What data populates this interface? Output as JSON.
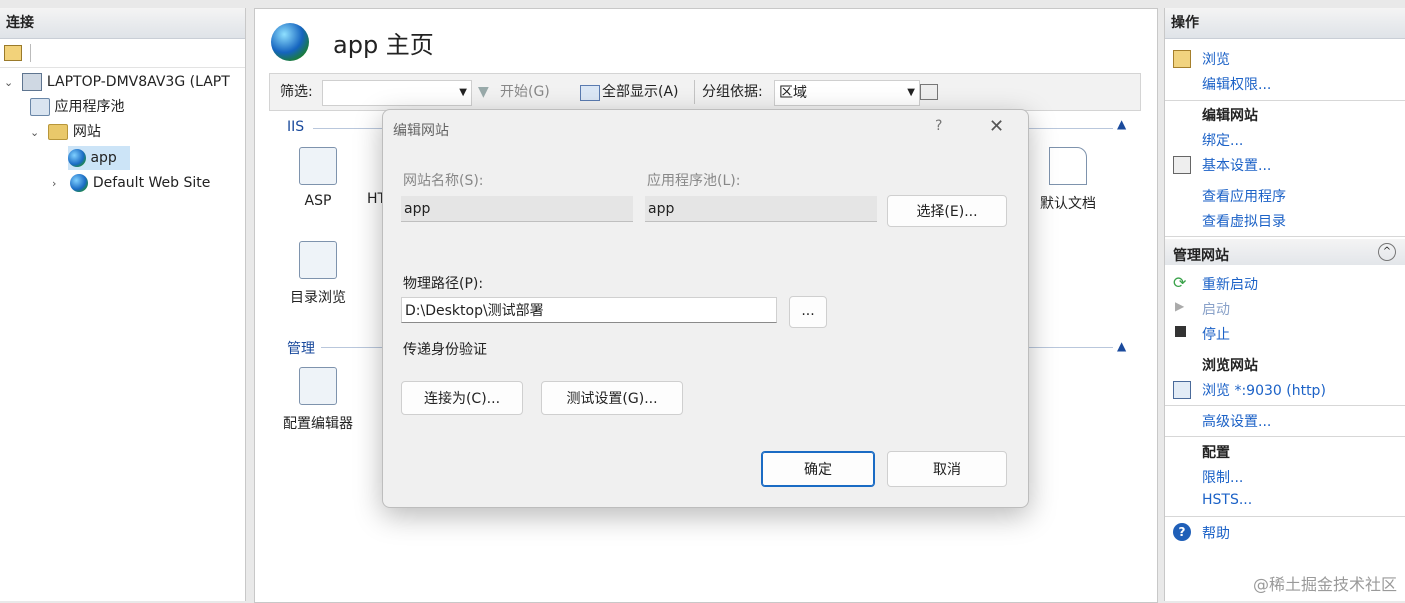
{
  "connections": {
    "title": "连接",
    "tree": [
      {
        "label": "LAPTOP-DMV8AV3G (LAPT",
        "icon": "computer-icon"
      },
      {
        "label": "应用程序池",
        "icon": "app-pool-icon"
      },
      {
        "label": "网站",
        "icon": "folder-icon"
      },
      {
        "label": "app",
        "icon": "globe-icon"
      },
      {
        "label": "Default Web Site",
        "icon": "globe-icon"
      }
    ]
  },
  "center": {
    "title": "app 主页",
    "filter": {
      "label": "筛选:",
      "value": "",
      "start": "开始(G)",
      "show_all": "全部显示(A)",
      "group_label": "分组依据:",
      "group_value": "区域"
    },
    "section_iis": "IIS",
    "section_manage": "管理",
    "features": {
      "asp": "ASP",
      "ht": "HT",
      "default_doc": "默认文档",
      "dir_browse": "目录浏览",
      "config_editor": "配置编辑器"
    }
  },
  "actions": {
    "title": "操作",
    "browse": "浏览",
    "edit_perm": "编辑权限...",
    "edit_site_head": "编辑网站",
    "bindings": "绑定...",
    "basic_settings": "基本设置...",
    "view_apps": "查看应用程序",
    "view_vdirs": "查看虚拟目录",
    "manage_head": "管理网站",
    "restart": "重新启动",
    "start": "启动",
    "stop": "停止",
    "browse_site_head": "浏览网站",
    "browse_port": "浏览 *:9030 (http)",
    "advanced": "高级设置...",
    "config_head": "配置",
    "limits": "限制...",
    "hsts": "HSTS...",
    "help": "帮助"
  },
  "dialog": {
    "title": "编辑网站",
    "help": "?",
    "site_name_label": "网站名称(S):",
    "site_name_value": "app",
    "app_pool_label": "应用程序池(L):",
    "app_pool_value": "app",
    "select_button": "选择(E)...",
    "physical_path_label": "物理路径(P):",
    "physical_path_value": "D:\\Desktop\\测试部署",
    "browse_button": "...",
    "passthrough_label": "传递身份验证",
    "connect_as_button": "连接为(C)...",
    "test_settings_button": "测试设置(G)...",
    "ok_button": "确定",
    "cancel_button": "取消"
  },
  "watermark": "@稀土掘金技术社区"
}
